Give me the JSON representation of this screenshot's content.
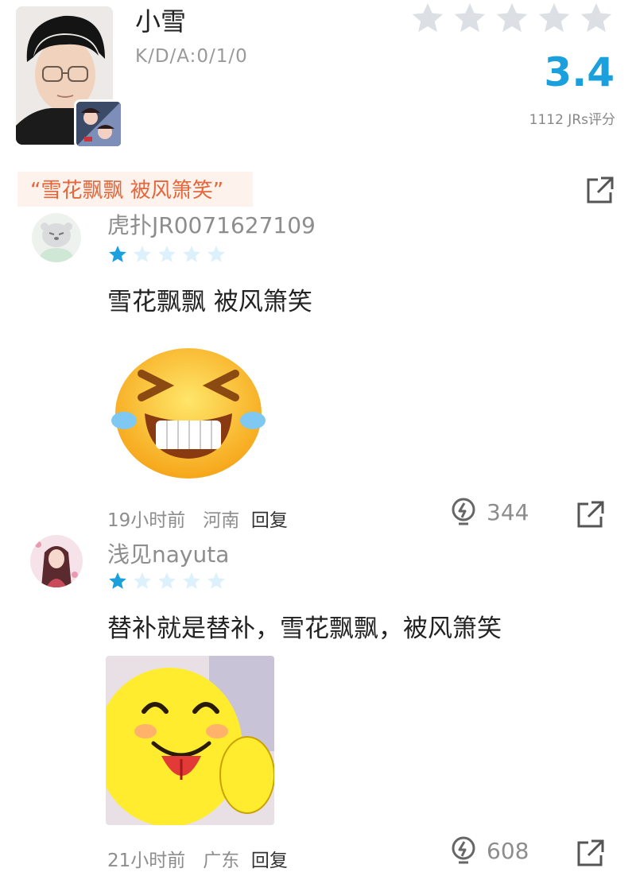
{
  "player": {
    "name": "小雪",
    "kda": "K/D/A:0/1/0",
    "score": "3.4",
    "rating_count": "1112 JRs评分",
    "stars_rating": 0
  },
  "hot_tag": "“雪花飘飘 被风箫笑”",
  "comments": [
    {
      "user": "虎扑JR0071627109",
      "stars": 1,
      "text": "雪花飘飘 被风箫笑",
      "time": "19小时前",
      "location": "河南",
      "reply": "回复",
      "likes": "344"
    },
    {
      "user": "浅见nayuta",
      "stars": 1,
      "text": "替补就是替补，雪花飘飘，被风箫笑",
      "time": "21小时前",
      "location": "广东",
      "reply": "回复",
      "likes": "608"
    }
  ],
  "colors": {
    "accent": "#1aa0dc",
    "tag_text": "#e4663a",
    "tag_bg": "#fdf2ec",
    "star_empty": "#dcdfe4",
    "star_filled": "#1aa0dc",
    "star_small_empty": "#dcf1fb"
  }
}
